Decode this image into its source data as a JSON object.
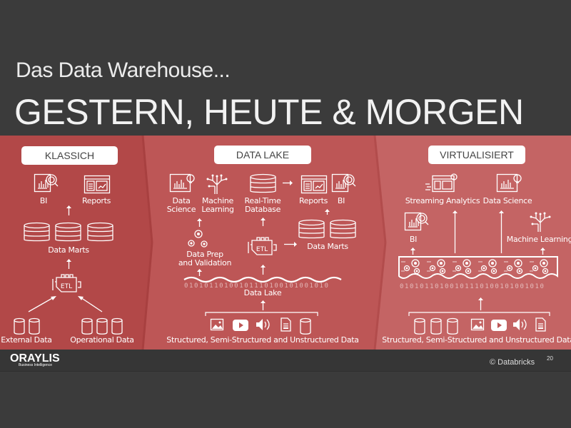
{
  "slide": {
    "title_line1": "Das Data Warehouse...",
    "title_line2": "GESTERN, HEUTE & MORGEN",
    "colors": {
      "background": "#3b3b3b",
      "panel_left": "#b24848",
      "panel_middle": "#bd5656",
      "panel_right": "#c46464"
    }
  },
  "klassich": {
    "header": "KLASSICH",
    "bi": "BI",
    "reports": "Reports",
    "data_marts": "Data Marts",
    "etl": "ETL",
    "external_data": "External Data",
    "operational_data": "Operational Data"
  },
  "data_lake": {
    "header": "DATA LAKE",
    "data_science_1": "Data",
    "data_science_2": "Science",
    "ml_1": "Machine",
    "ml_2": "Learning",
    "rtdb_1": "Real-Time",
    "rtdb_2": "Database",
    "reports": "Reports",
    "bi": "BI",
    "prep_1": "Data Prep",
    "prep_2": "and Validation",
    "etl": "ETL",
    "data_marts": "Data Marts",
    "binary": "01010110100101110100101001010",
    "data_lake": "Data Lake",
    "sources": "Structured, Semi-Structured and Unstructured Data"
  },
  "virtualisiert": {
    "header": "VIRTUALISIERT",
    "streaming": "Streaming Analytics",
    "data_science": "Data Science",
    "bi": "BI",
    "ml": "Machine Learning",
    "binary": "01010110100101110100101001010",
    "sources": "Structured, Semi-Structured and Unstructured Data"
  },
  "footer": {
    "logo": "ORAYLIS",
    "logo_sub": "Business Intelligence",
    "copyright": "© Databricks",
    "page_number": "20"
  },
  "icons": [
    "chart-icon",
    "bi-target-icon",
    "report-dashboard-icon",
    "database-icon",
    "cylinder-icon",
    "etl-engine-icon",
    "brain-tree-icon",
    "lightbulb-chart-icon",
    "gears-icon",
    "image-icon",
    "video-icon",
    "speaker-icon",
    "document-icon",
    "arrow-up-icon",
    "arrow-right-icon"
  ]
}
